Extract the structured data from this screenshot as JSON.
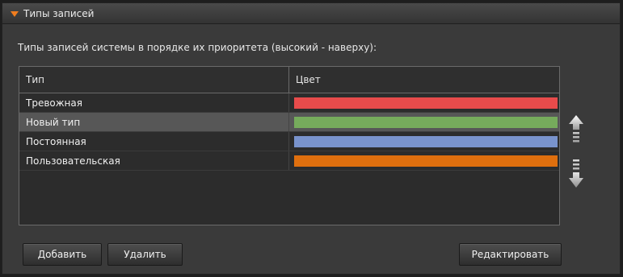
{
  "panel": {
    "title": "Типы записей",
    "description": "Типы записей системы в порядке их приоритета (высокий - наверху):"
  },
  "table": {
    "columns": [
      "Тип",
      "Цвет"
    ],
    "rows": [
      {
        "name": "Тревожная",
        "color": "#e84b4b",
        "selected": false
      },
      {
        "name": "Новый тип",
        "color": "#76ab5c",
        "selected": true
      },
      {
        "name": "Постоянная",
        "color": "#7993cc",
        "selected": false
      },
      {
        "name": "Пользовательская",
        "color": "#df6f0e",
        "selected": false
      }
    ]
  },
  "buttons": {
    "add": "Добавить",
    "delete": "Удалить",
    "edit": "Редактировать"
  },
  "icons": {
    "header": "collapse-caret-icon",
    "move_up": "move-up-icon",
    "move_down": "move-down-icon"
  },
  "colors": {
    "accent": "#f07d1e",
    "background": "#3a3a3a"
  }
}
